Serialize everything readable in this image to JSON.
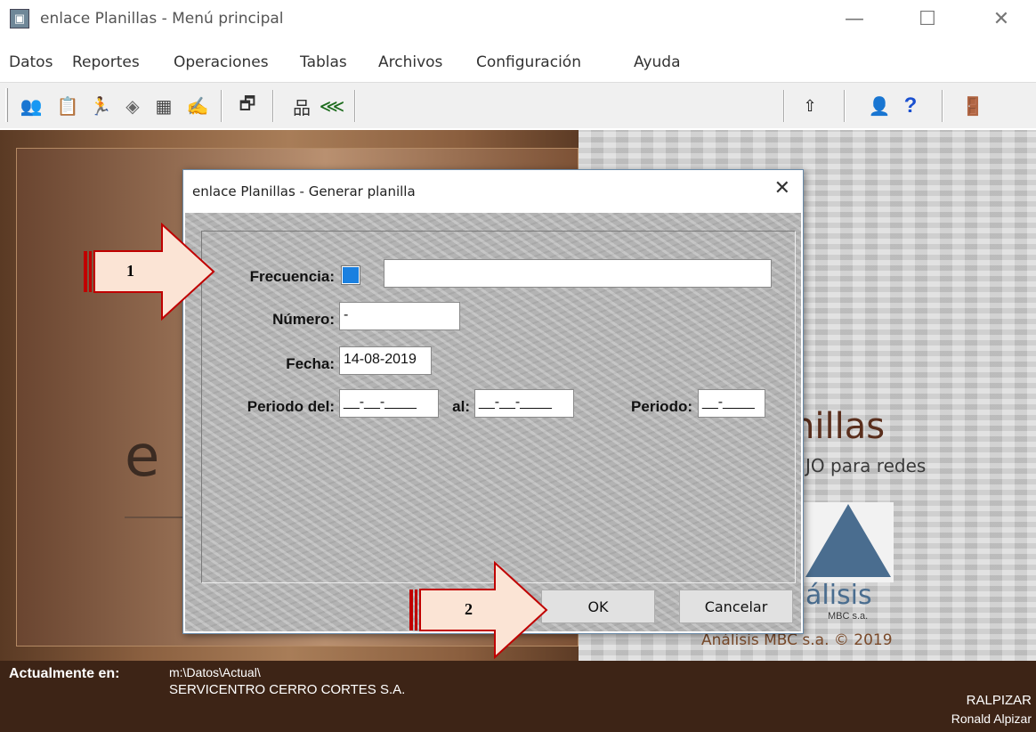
{
  "window": {
    "title": "enlace Planillas - Menú principal",
    "minimize": "—",
    "maximize": "☐",
    "close": "✕"
  },
  "menu": [
    "Datos",
    "Reportes",
    "Operaciones",
    "Tablas",
    "Archivos",
    "Configuración",
    "Ayuda"
  ],
  "toolbar": {
    "icons": [
      "people-icon",
      "form-icon",
      "runner-icon",
      "tag-icon",
      "chart-icon",
      "edit-icon",
      "window-icon",
      "network-icon",
      "tree-icon",
      "up-arrow-icon",
      "help-person-icon",
      "question-icon",
      "exit-door-icon"
    ]
  },
  "background": {
    "letter": "e",
    "app_title_fragment": "nillas",
    "app_subtitle_fragment": "JO para redes",
    "logo_text_fragment": "álisis",
    "logo_small": "MBC s.a.",
    "copyright": "Análisis MBC s.a. © 2019"
  },
  "dialog": {
    "title": "enlace Planillas - Generar planilla",
    "close": "✕",
    "frecuencia_label": "Frecuencia:",
    "frecuencia_value": "",
    "numero_label": "Número:",
    "numero_value": "-",
    "fecha_label": "Fecha:",
    "fecha_value": "14-08-2019",
    "periodo_del_label": "Periodo del:",
    "periodo_del_value": "__-__-____",
    "al_label": "al:",
    "al_value": "__-__-____",
    "periodo_label": "Periodo:",
    "periodo_value": "__-____",
    "ok_label": "OK",
    "cancel_label": "Cancelar"
  },
  "callouts": {
    "one": "1",
    "two": "2"
  },
  "status": {
    "label": "Actualmente en:",
    "path": "m:\\Datos\\Actual\\",
    "company": "SERVICENTRO CERRO CORTES S.A.",
    "user_code": "RALPIZAR",
    "user_name": "Ronald Alpizar"
  }
}
